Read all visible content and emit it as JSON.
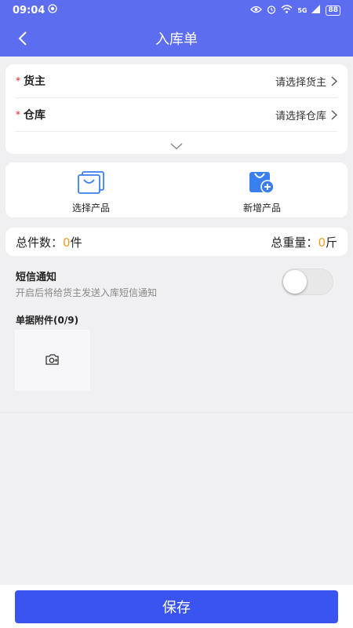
{
  "status_bar": {
    "time": "09:04",
    "signal_tag": "5G",
    "battery": "88"
  },
  "nav": {
    "title": "入库单"
  },
  "form": {
    "required_mark": "*",
    "owner_label": "货主",
    "owner_placeholder": "请选择货主",
    "warehouse_label": "仓库",
    "warehouse_placeholder": "请选择仓库"
  },
  "actions": {
    "select_product": "选择产品",
    "add_product": "新增产品"
  },
  "summary": {
    "total_count_label": "总件数：",
    "total_count_value": "0",
    "total_count_unit": "件",
    "total_weight_label": "总重量：",
    "total_weight_value": "0",
    "total_weight_unit": "斤"
  },
  "sms": {
    "title": "短信通知",
    "desc": "开启后将给货主发送入库短信通知",
    "enabled": false
  },
  "attachments": {
    "title": "单据附件(0/9)"
  },
  "footer": {
    "save_label": "保存"
  },
  "colors": {
    "header": "#5c6df0",
    "primary_button": "#3a55ef",
    "accent_number": "#f0a020",
    "required": "#e02020"
  },
  "icons": [
    "back-arrow-icon",
    "chevron-right-icon",
    "chevron-down-icon",
    "shopping-bag-icon",
    "add-product-icon",
    "camera-add-icon"
  ]
}
